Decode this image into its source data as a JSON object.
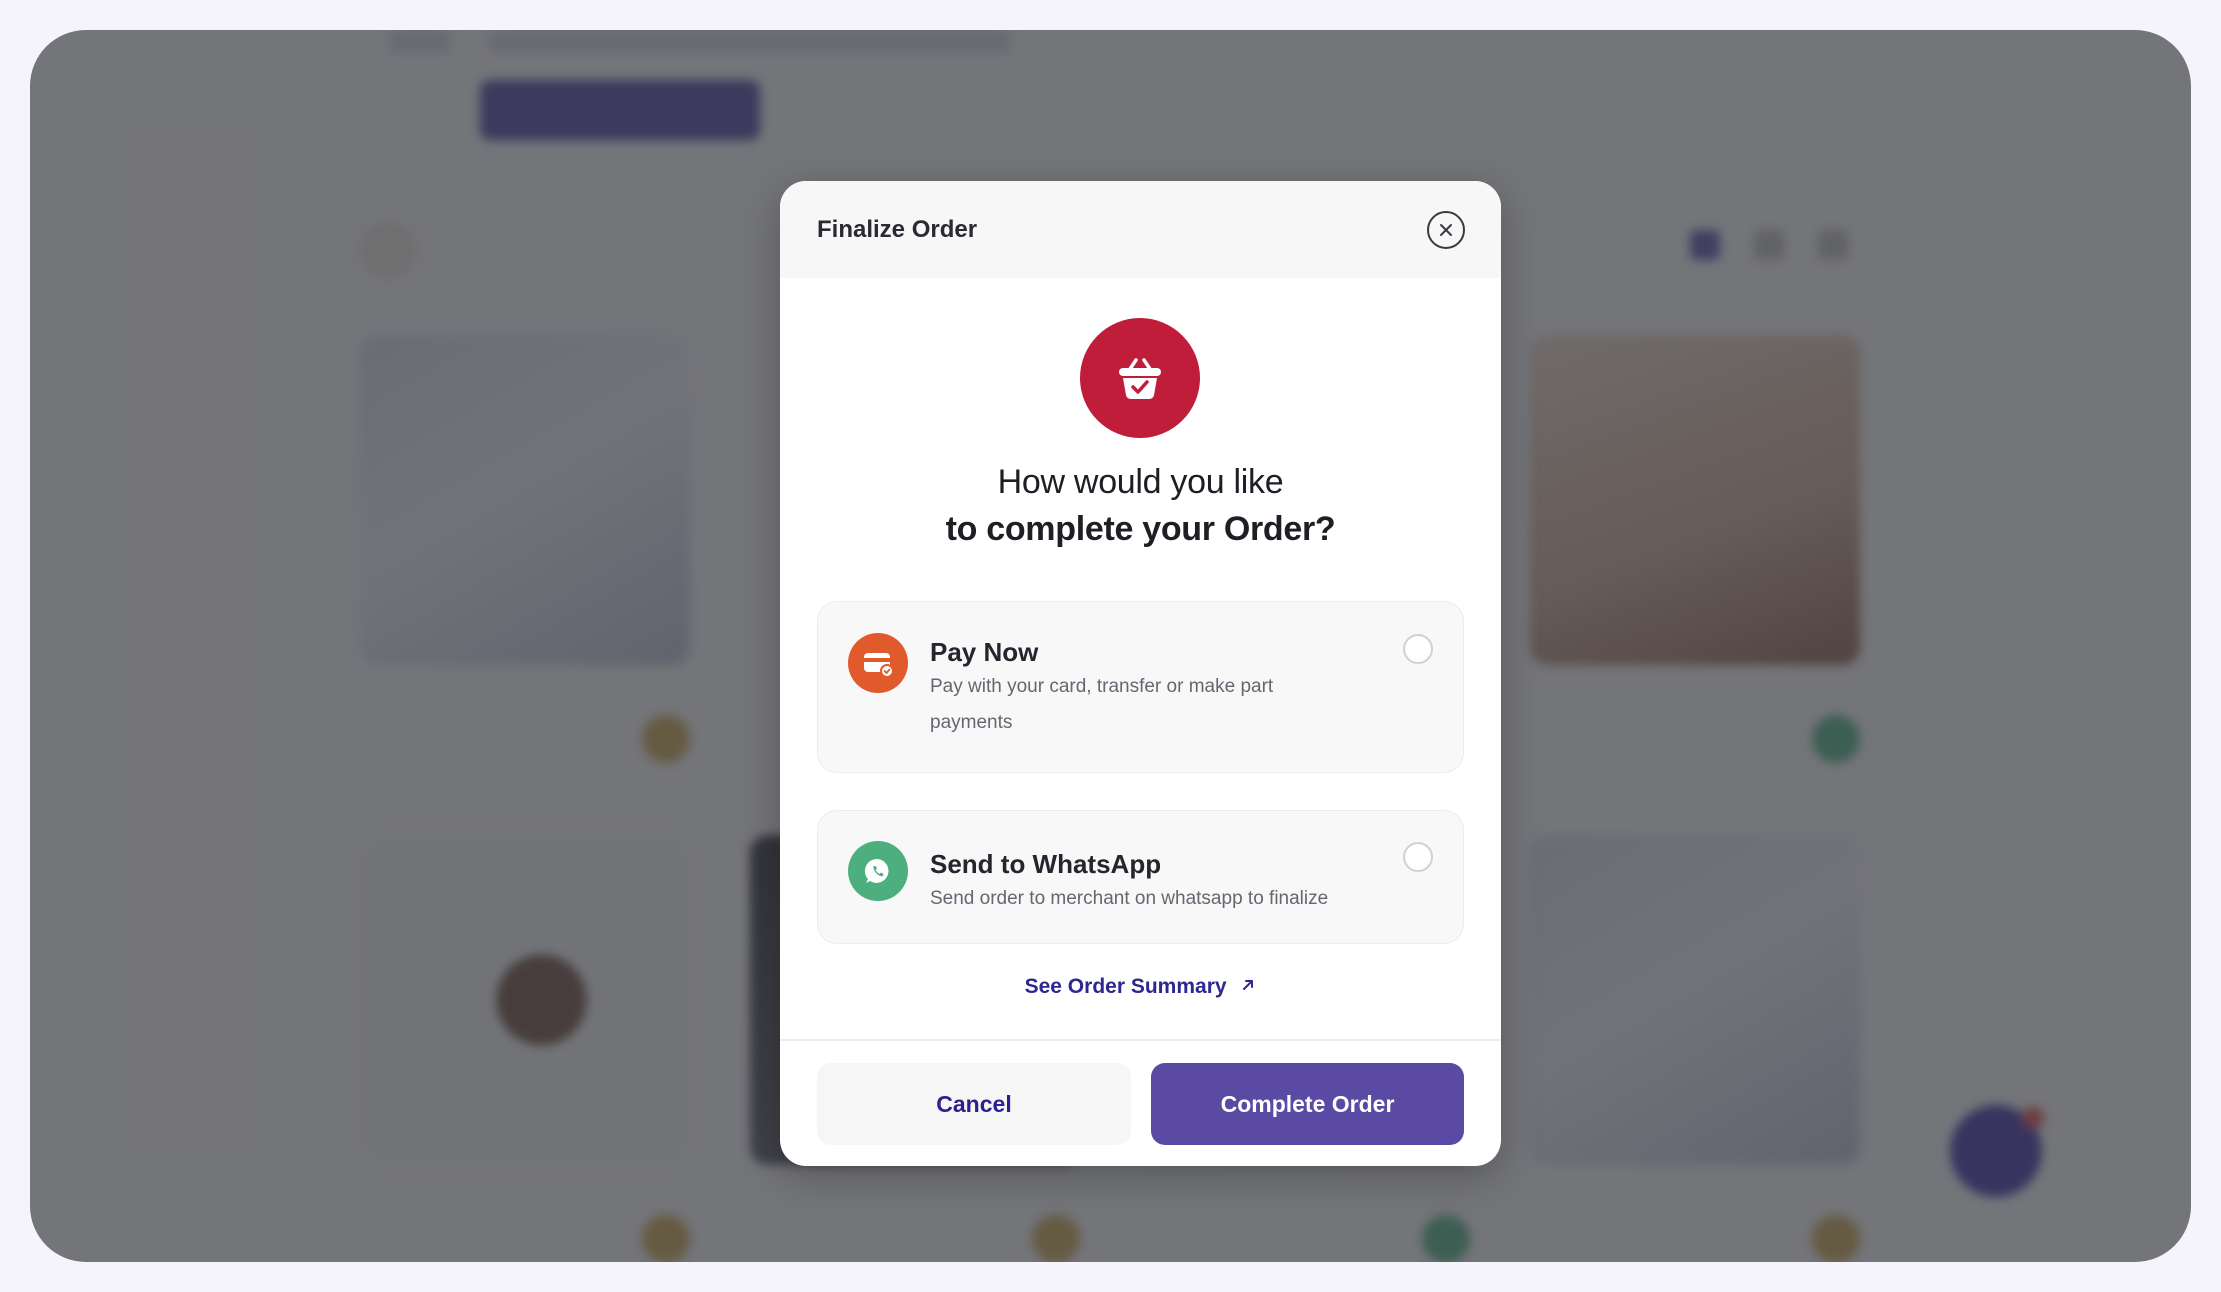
{
  "modal": {
    "title": "Finalize Order",
    "question_line1": "How would you like",
    "question_line2": "to complete your Order?",
    "options": [
      {
        "title": "Pay Now",
        "description": "Pay with your card, transfer or make part payments",
        "icon": "card-icon",
        "color": "#e05a2b",
        "selected": false
      },
      {
        "title": "Send to WhatsApp",
        "description": "Send order to merchant on whatsapp to finalize",
        "icon": "whatsapp-icon",
        "color": "#4caf7d",
        "selected": false
      }
    ],
    "summary_link": "See Order Summary",
    "cancel_label": "Cancel",
    "complete_label": "Complete Order"
  },
  "colors": {
    "accent": "#5a4aa3",
    "hero": "#bf1d3a",
    "link": "#2f2790"
  }
}
